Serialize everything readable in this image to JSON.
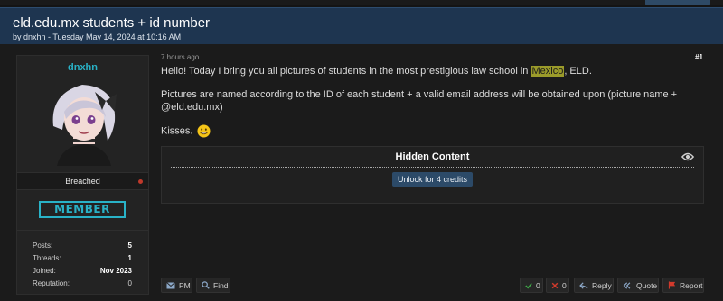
{
  "thread": {
    "title": "eld.edu.mx students + id number",
    "byline": "by dnxhn - Tuesday May 14, 2024 at 10:16 AM"
  },
  "user": {
    "name": "dnxhn",
    "status": "Breached",
    "badge": "MEMBER",
    "stats": [
      {
        "label": "Posts:",
        "value": "5"
      },
      {
        "label": "Threads:",
        "value": "1"
      },
      {
        "label": "Joined:",
        "value": "Nov 2023"
      },
      {
        "label": "Reputation:",
        "value": "0"
      }
    ]
  },
  "post": {
    "time": "7 hours ago",
    "number": "#1",
    "line1_before": "Hello! Today I bring you all pictures of students in the most prestigious law school in ",
    "line1_highlight": "Mexico",
    "line1_after": ", ELD.",
    "line2": "Pictures are named according to the ID of each student + a valid email address will be obtained upon (picture name + @eld.edu.mx)",
    "line3": "Kisses."
  },
  "hidden": {
    "title": "Hidden Content",
    "unlock_label": "Unlock for 4 credits"
  },
  "actions": {
    "pm": "PM",
    "find": "Find",
    "upvotes": "0",
    "downvotes": "0",
    "reply": "Reply",
    "quote": "Quote",
    "report": "Report"
  },
  "colors": {
    "header_bg": "#1e3550",
    "accent_cyan": "#29b2c7",
    "highlight": "#9b9b2a",
    "unlock_bg": "#2c4a68",
    "upvote": "#3fae49",
    "downvote": "#d33a2c",
    "report": "#d33a2c"
  },
  "icons": [
    "avatar-image",
    "status-dot",
    "grin-emoji-icon",
    "eye-icon",
    "mail-icon",
    "search-icon",
    "check-icon",
    "x-icon",
    "reply-icon",
    "quote-icon",
    "flag-icon"
  ]
}
